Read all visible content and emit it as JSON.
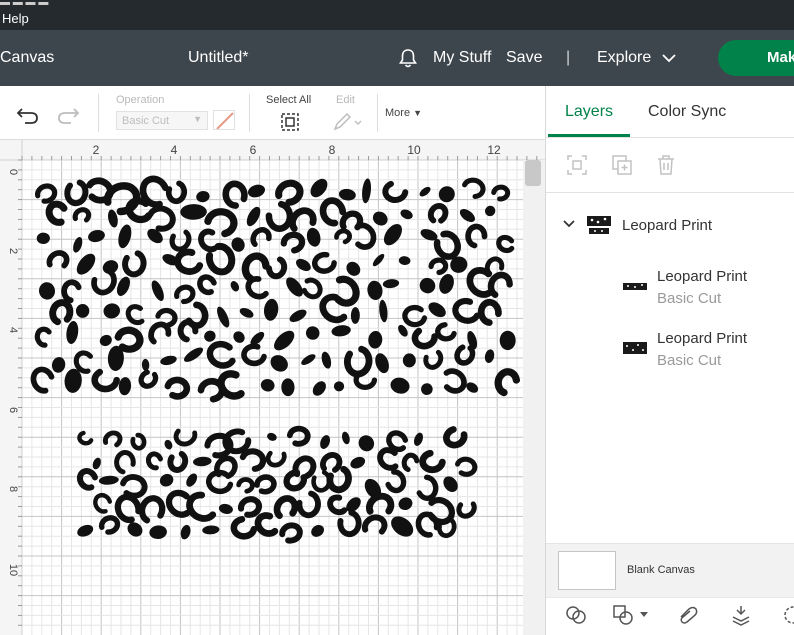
{
  "menubar": {
    "help_label": "Help"
  },
  "header": {
    "canvas_label": "Canvas",
    "doc_title": "Untitled*",
    "my_stuff_label": "My Stuff",
    "save_label": "Save",
    "divider": "|",
    "explore_label": "Explore",
    "make_label": "Mak"
  },
  "toolbar": {
    "operation_label": "Operation",
    "operation_value": "Basic Cut",
    "select_all_label": "Select All",
    "edit_label": "Edit",
    "more_label": "More"
  },
  "ruler": {
    "top_ticks": [
      "2",
      "4",
      "6",
      "8",
      "10",
      "12"
    ],
    "left_ticks": [
      "0",
      "2",
      "4",
      "6",
      "8",
      "10"
    ]
  },
  "panel": {
    "tabs": [
      {
        "label": "Layers",
        "active": true
      },
      {
        "label": "Color Sync",
        "active": false
      }
    ],
    "group": {
      "name": "Leopard Print"
    },
    "layers": [
      {
        "name": "Leopard Print",
        "operation": "Basic Cut"
      },
      {
        "name": "Leopard Print",
        "operation": "Basic Cut"
      }
    ],
    "blank_canvas_label": "Blank Canvas"
  },
  "colors": {
    "accent": "#00824a",
    "header_bg": "#3e464d",
    "menubar_bg": "#252a2e",
    "grid_line": "#d6d6d6",
    "ruler_bg": "#f5f5f5",
    "print_fill": "#111111"
  }
}
